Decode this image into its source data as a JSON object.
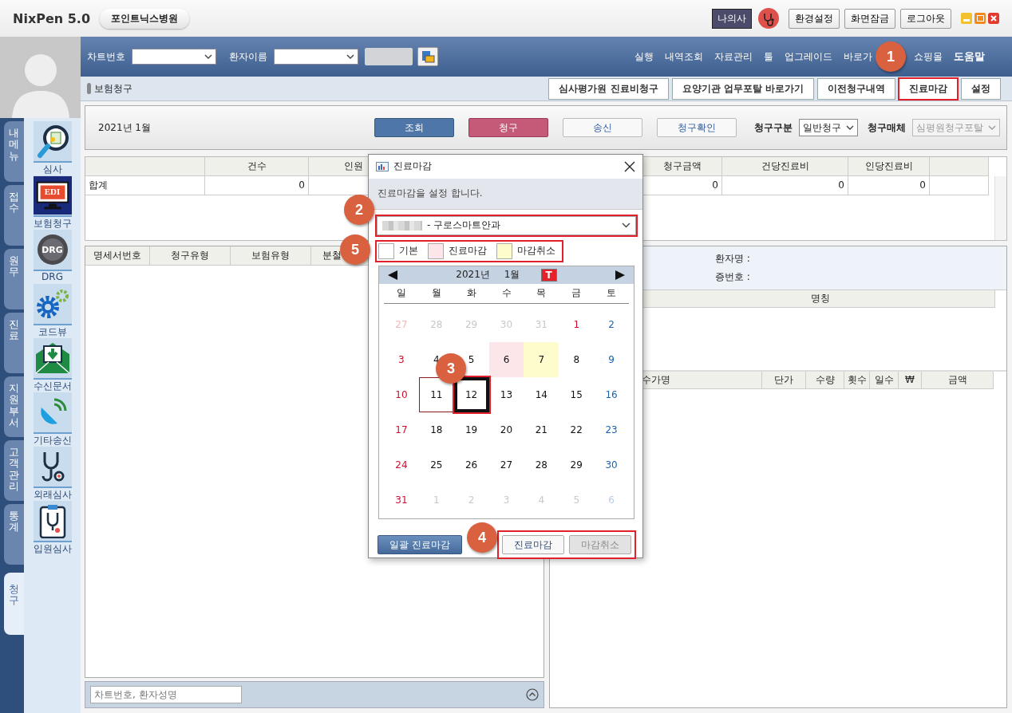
{
  "app": {
    "title": "NixPen 5.0",
    "hospital": "포인트닉스병원",
    "profile_button": "나의사",
    "top_buttons": [
      "환경설정",
      "화면잠금",
      "로그아웃"
    ]
  },
  "vertical_tabs": [
    {
      "label": "내메뉴",
      "selected": false
    },
    {
      "label": "접수",
      "selected": false
    },
    {
      "label": "원무",
      "selected": false
    },
    {
      "label": "진료",
      "selected": false
    },
    {
      "label": "지원부서",
      "selected": false
    },
    {
      "label": "고객관리",
      "selected": false
    },
    {
      "label": "통계",
      "selected": false
    },
    {
      "label": "청구",
      "selected": true
    }
  ],
  "shortcuts": [
    {
      "label": "심사",
      "kind": "review"
    },
    {
      "label": "보험청구",
      "kind": "edi",
      "badge": "EDI"
    },
    {
      "label": "DRG",
      "kind": "drg",
      "badge": "DRG"
    },
    {
      "label": "코드뷰",
      "kind": "code"
    },
    {
      "label": "수신문서",
      "kind": "inbox"
    },
    {
      "label": "기타송신",
      "kind": "dish"
    },
    {
      "label": "외래심사",
      "kind": "stethoscope"
    },
    {
      "label": "입원심사",
      "kind": "clipboard"
    }
  ],
  "search_bar": {
    "chart_label": "차트번호",
    "patient_label": "환자이름"
  },
  "menu": [
    {
      "label": "실행",
      "bold": false
    },
    {
      "label": "내역조회",
      "bold": false
    },
    {
      "label": "자료관리",
      "bold": false
    },
    {
      "label": "툴",
      "bold": false
    },
    {
      "label": "업그레이드",
      "bold": false
    },
    {
      "label": "바로가",
      "bold": false
    },
    {
      "label": "쇼핑몰",
      "bold": false
    },
    {
      "label": "도움말",
      "bold": true
    }
  ],
  "section_title": "보험청구",
  "section_buttons": [
    {
      "label": "심사평가원 진료비청구",
      "highlighted": false
    },
    {
      "label": "요양기관 업무포탈 바로가기",
      "highlighted": false
    },
    {
      "label": "이전청구내역",
      "highlighted": false
    },
    {
      "label": "진료마감",
      "highlighted": true
    },
    {
      "label": "설정",
      "highlighted": false
    }
  ],
  "filter": {
    "period": "2021년  1월",
    "buttons": [
      {
        "label": "조회",
        "kind": "primary"
      },
      {
        "label": "청구",
        "kind": "danger"
      },
      {
        "label": "송신",
        "kind": "plain"
      },
      {
        "label": "청구확인",
        "kind": "plain"
      }
    ],
    "claim_type": {
      "label": "청구구분",
      "value": "일반청구",
      "disabled": false
    },
    "claim_medium": {
      "label": "청구매체",
      "value": "심평원청구포탈",
      "disabled": true
    }
  },
  "summary": {
    "row_label": "합계",
    "columns": [
      {
        "label": "건수",
        "value": "0"
      },
      {
        "label": "인원"
      },
      {
        "label": "청구금액",
        "value": "0"
      },
      {
        "label": "건당진료비",
        "value": "0"
      },
      {
        "label": "인당진료비",
        "value": "0"
      }
    ]
  },
  "statement_list": {
    "columns": [
      "명세서번호",
      "청구유형",
      "보험유형",
      "분철"
    ],
    "search_placeholder": "차트번호, 환자성명"
  },
  "patient": {
    "name_label": "환자명  :",
    "id_label": "증번호  :"
  },
  "name_table": {
    "columns": [
      "명칭"
    ]
  },
  "fee_table": {
    "columns": [
      "수가명",
      "단가",
      "수량",
      "횟수",
      "일수",
      "₩",
      "금액"
    ]
  },
  "dialog": {
    "title": "진료마감",
    "description": "진료마감을 설정 합니다.",
    "department": "- 구로스마트안과",
    "department_highlighted": true,
    "legend_highlighted": true,
    "actions_highlighted": true,
    "legend": [
      {
        "label": "기본",
        "color": "#ffffff"
      },
      {
        "label": "진료마감",
        "color": "#fde6ea"
      },
      {
        "label": "마감취소",
        "color": "#fefccc"
      }
    ],
    "calendar": {
      "year": "2021년",
      "month": "1월",
      "today_badge": "T",
      "weekdays": [
        "일",
        "월",
        "화",
        "수",
        "목",
        "금",
        "토"
      ],
      "days": [
        {
          "d": "27",
          "kind": "sunday",
          "outside": true,
          "closed": false,
          "cancelled": false,
          "selected": false,
          "today": false
        },
        {
          "d": "28",
          "kind": "weekday",
          "outside": true,
          "closed": false,
          "cancelled": false,
          "selected": false,
          "today": false
        },
        {
          "d": "29",
          "kind": "weekday",
          "outside": true,
          "closed": false,
          "cancelled": false,
          "selected": false,
          "today": false
        },
        {
          "d": "30",
          "kind": "weekday",
          "outside": true,
          "closed": false,
          "cancelled": false,
          "selected": false,
          "today": false
        },
        {
          "d": "31",
          "kind": "weekday",
          "outside": true,
          "closed": false,
          "cancelled": false,
          "selected": false,
          "today": false
        },
        {
          "d": "1",
          "kind": "holiday",
          "outside": false,
          "closed": false,
          "cancelled": false,
          "selected": false,
          "today": false
        },
        {
          "d": "2",
          "kind": "saturday",
          "outside": false,
          "closed": false,
          "cancelled": false,
          "selected": false,
          "today": false
        },
        {
          "d": "3",
          "kind": "sunday",
          "outside": false,
          "closed": false,
          "cancelled": false,
          "selected": false,
          "today": false
        },
        {
          "d": "4",
          "kind": "weekday",
          "outside": false,
          "closed": false,
          "cancelled": false,
          "selected": false,
          "today": false
        },
        {
          "d": "5",
          "kind": "weekday",
          "outside": false,
          "closed": false,
          "cancelled": false,
          "selected": false,
          "today": false
        },
        {
          "d": "6",
          "kind": "weekday",
          "outside": false,
          "closed": true,
          "cancelled": false,
          "selected": false,
          "today": false
        },
        {
          "d": "7",
          "kind": "weekday",
          "outside": false,
          "closed": false,
          "cancelled": true,
          "selected": false,
          "today": false
        },
        {
          "d": "8",
          "kind": "weekday",
          "outside": false,
          "closed": false,
          "cancelled": false,
          "selected": false,
          "today": false
        },
        {
          "d": "9",
          "kind": "saturday",
          "outside": false,
          "closed": false,
          "cancelled": false,
          "selected": false,
          "today": false
        },
        {
          "d": "10",
          "kind": "sunday",
          "outside": false,
          "closed": false,
          "cancelled": false,
          "selected": false,
          "today": false
        },
        {
          "d": "11",
          "kind": "weekday",
          "outside": false,
          "closed": false,
          "cancelled": false,
          "selected": false,
          "today": true
        },
        {
          "d": "12",
          "kind": "weekday",
          "outside": false,
          "closed": false,
          "cancelled": false,
          "selected": true,
          "today": false
        },
        {
          "d": "13",
          "kind": "weekday",
          "outside": false,
          "closed": false,
          "cancelled": false,
          "selected": false,
          "today": false
        },
        {
          "d": "14",
          "kind": "weekday",
          "outside": false,
          "closed": false,
          "cancelled": false,
          "selected": false,
          "today": false
        },
        {
          "d": "15",
          "kind": "weekday",
          "outside": false,
          "closed": false,
          "cancelled": false,
          "selected": false,
          "today": false
        },
        {
          "d": "16",
          "kind": "saturday",
          "outside": false,
          "closed": false,
          "cancelled": false,
          "selected": false,
          "today": false
        },
        {
          "d": "17",
          "kind": "sunday",
          "outside": false,
          "closed": false,
          "cancelled": false,
          "selected": false,
          "today": false
        },
        {
          "d": "18",
          "kind": "weekday",
          "outside": false,
          "closed": false,
          "cancelled": false,
          "selected": false,
          "today": false
        },
        {
          "d": "19",
          "kind": "weekday",
          "outside": false,
          "closed": false,
          "cancelled": false,
          "selected": false,
          "today": false
        },
        {
          "d": "20",
          "kind": "weekday",
          "outside": false,
          "closed": false,
          "cancelled": false,
          "selected": false,
          "today": false
        },
        {
          "d": "21",
          "kind": "weekday",
          "outside": false,
          "closed": false,
          "cancelled": false,
          "selected": false,
          "today": false
        },
        {
          "d": "22",
          "kind": "weekday",
          "outside": false,
          "closed": false,
          "cancelled": false,
          "selected": false,
          "today": false
        },
        {
          "d": "23",
          "kind": "saturday",
          "outside": false,
          "closed": false,
          "cancelled": false,
          "selected": false,
          "today": false
        },
        {
          "d": "24",
          "kind": "sunday",
          "outside": false,
          "closed": false,
          "cancelled": false,
          "selected": false,
          "today": false
        },
        {
          "d": "25",
          "kind": "weekday",
          "outside": false,
          "closed": false,
          "cancelled": false,
          "selected": false,
          "today": false
        },
        {
          "d": "26",
          "kind": "weekday",
          "outside": false,
          "closed": false,
          "cancelled": false,
          "selected": false,
          "today": false
        },
        {
          "d": "27",
          "kind": "weekday",
          "outside": false,
          "closed": false,
          "cancelled": false,
          "selected": false,
          "today": false
        },
        {
          "d": "28",
          "kind": "weekday",
          "outside": false,
          "closed": false,
          "cancelled": false,
          "selected": false,
          "today": false
        },
        {
          "d": "29",
          "kind": "weekday",
          "outside": false,
          "closed": false,
          "cancelled": false,
          "selected": false,
          "today": false
        },
        {
          "d": "30",
          "kind": "saturday",
          "outside": false,
          "closed": false,
          "cancelled": false,
          "selected": false,
          "today": false
        },
        {
          "d": "31",
          "kind": "sunday",
          "outside": false,
          "closed": false,
          "cancelled": false,
          "selected": false,
          "today": false
        },
        {
          "d": "1",
          "kind": "weekday",
          "outside": true,
          "closed": false,
          "cancelled": false,
          "selected": false,
          "today": false
        },
        {
          "d": "2",
          "kind": "weekday",
          "outside": true,
          "closed": false,
          "cancelled": false,
          "selected": false,
          "today": false
        },
        {
          "d": "3",
          "kind": "weekday",
          "outside": true,
          "closed": false,
          "cancelled": false,
          "selected": false,
          "today": false
        },
        {
          "d": "4",
          "kind": "weekday",
          "outside": true,
          "closed": false,
          "cancelled": false,
          "selected": false,
          "today": false
        },
        {
          "d": "5",
          "kind": "weekday",
          "outside": true,
          "closed": false,
          "cancelled": false,
          "selected": false,
          "today": false
        },
        {
          "d": "6",
          "kind": "saturday",
          "outside": true,
          "closed": false,
          "cancelled": false,
          "selected": false,
          "today": false
        }
      ]
    },
    "buttons": [
      {
        "label": "일괄 진료마감",
        "kind": "primary",
        "disabled": false
      },
      {
        "label": "진료마감",
        "kind": "plain",
        "disabled": false
      },
      {
        "label": "마감취소",
        "kind": "plain",
        "disabled": true
      }
    ]
  },
  "callouts": [
    "1",
    "2",
    "3",
    "4",
    "5"
  ]
}
